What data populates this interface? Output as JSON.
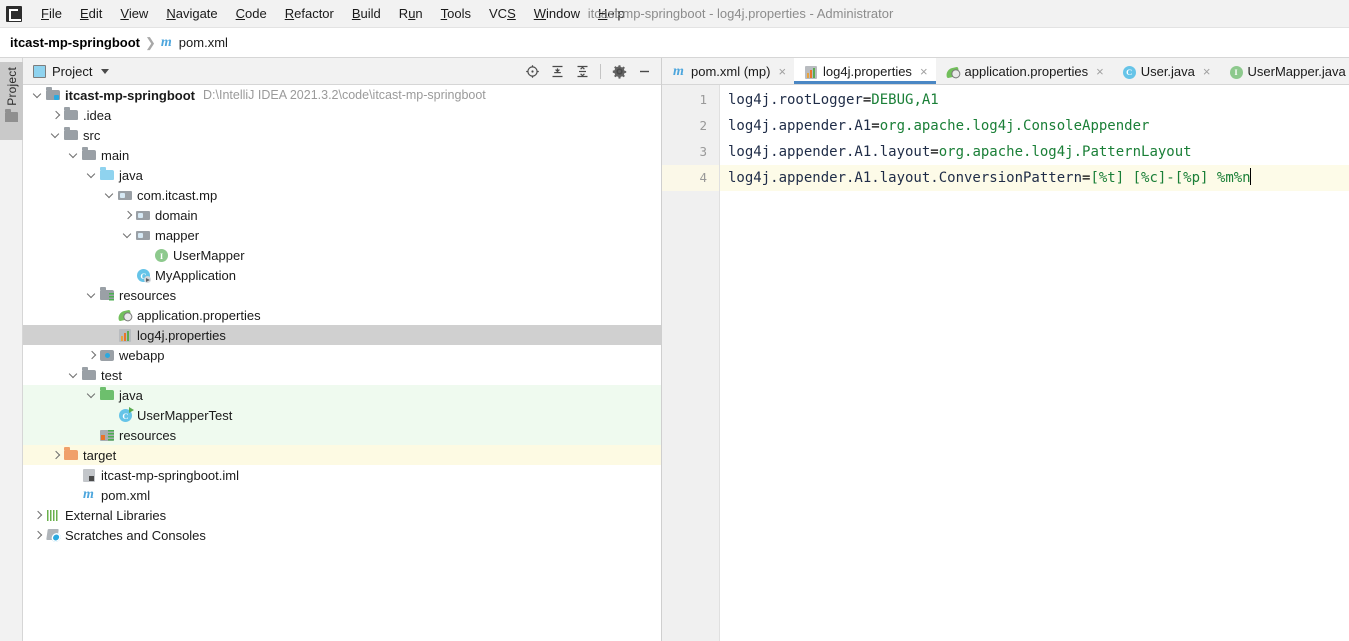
{
  "window": {
    "title": "itcast-mp-springboot - log4j.properties - Administrator"
  },
  "menu": {
    "items": [
      {
        "label": "File",
        "mnemonic": "F"
      },
      {
        "label": "Edit",
        "mnemonic": "E"
      },
      {
        "label": "View",
        "mnemonic": "V"
      },
      {
        "label": "Navigate",
        "mnemonic": "N"
      },
      {
        "label": "Code",
        "mnemonic": "C"
      },
      {
        "label": "Refactor",
        "mnemonic": "R"
      },
      {
        "label": "Build",
        "mnemonic": "B"
      },
      {
        "label": "Run",
        "mnemonic": "u"
      },
      {
        "label": "Tools",
        "mnemonic": "T"
      },
      {
        "label": "VCS",
        "mnemonic": "S"
      },
      {
        "label": "Window",
        "mnemonic": "W"
      },
      {
        "label": "Help",
        "mnemonic": "H"
      }
    ]
  },
  "breadcrumb": {
    "root": "itcast-mp-springboot",
    "separator": "❯",
    "leaf": "pom.xml",
    "leaf_icon": "maven-icon",
    "leaf_icon_glyph": "m"
  },
  "toolstrip": {
    "project_tab_label": "Project",
    "project_tab_icon": "folder-icon"
  },
  "project_panel": {
    "title": "Project",
    "title_icon": "project-view-icon",
    "dropdown_icon": "chevron-down-icon",
    "actions": [
      {
        "name": "select-opened-file-icon",
        "tooltip": "Select Opened File"
      },
      {
        "name": "expand-all-icon",
        "tooltip": "Expand All"
      },
      {
        "name": "collapse-all-icon",
        "tooltip": "Collapse All"
      },
      {
        "name": "gear-icon",
        "tooltip": "Options"
      },
      {
        "name": "hide-icon",
        "tooltip": "Hide"
      }
    ]
  },
  "tree": {
    "rows": [
      {
        "indent": 0,
        "arrow": "down",
        "icon": "module-folder-icon",
        "label": "itcast-mp-springboot",
        "bold": true,
        "hint": "D:\\IntelliJ IDEA 2021.3.2\\code\\itcast-mp-springboot",
        "state": "normal"
      },
      {
        "indent": 1,
        "arrow": "right",
        "icon": "folder-icon",
        "label": ".idea",
        "bold": false,
        "hint": "",
        "state": "normal"
      },
      {
        "indent": 1,
        "arrow": "down",
        "icon": "folder-icon",
        "label": "src",
        "bold": false,
        "hint": "",
        "state": "normal"
      },
      {
        "indent": 2,
        "arrow": "down",
        "icon": "folder-icon",
        "label": "main",
        "bold": false,
        "hint": "",
        "state": "normal"
      },
      {
        "indent": 3,
        "arrow": "down",
        "icon": "source-folder-icon",
        "label": "java",
        "bold": false,
        "hint": "",
        "state": "normal"
      },
      {
        "indent": 4,
        "arrow": "down",
        "icon": "package-icon",
        "label": "com.itcast.mp",
        "bold": false,
        "hint": "",
        "state": "normal"
      },
      {
        "indent": 5,
        "arrow": "right",
        "icon": "package-icon",
        "label": "domain",
        "bold": false,
        "hint": "",
        "state": "normal"
      },
      {
        "indent": 5,
        "arrow": "down",
        "icon": "package-icon",
        "label": "mapper",
        "bold": false,
        "hint": "",
        "state": "normal"
      },
      {
        "indent": 6,
        "arrow": "none",
        "icon": "interface-icon",
        "label": "UserMapper",
        "bold": false,
        "hint": "",
        "state": "normal"
      },
      {
        "indent": 5,
        "arrow": "none",
        "icon": "spring-class-icon",
        "label": "MyApplication",
        "bold": false,
        "hint": "",
        "state": "normal"
      },
      {
        "indent": 3,
        "arrow": "down",
        "icon": "resources-folder-icon",
        "label": "resources",
        "bold": false,
        "hint": "",
        "state": "normal"
      },
      {
        "indent": 4,
        "arrow": "none",
        "icon": "spring-properties-icon",
        "label": "application.properties",
        "bold": false,
        "hint": "",
        "state": "normal"
      },
      {
        "indent": 4,
        "arrow": "none",
        "icon": "properties-file-icon",
        "label": "log4j.properties",
        "bold": false,
        "hint": "",
        "state": "selected"
      },
      {
        "indent": 3,
        "arrow": "right",
        "icon": "webapp-folder-icon",
        "label": "webapp",
        "bold": false,
        "hint": "",
        "state": "normal"
      },
      {
        "indent": 2,
        "arrow": "down",
        "icon": "folder-icon",
        "label": "test",
        "bold": false,
        "hint": "",
        "state": "normal"
      },
      {
        "indent": 3,
        "arrow": "down",
        "icon": "test-source-folder-icon",
        "label": "java",
        "bold": false,
        "hint": "",
        "state": "green"
      },
      {
        "indent": 4,
        "arrow": "none",
        "icon": "test-class-icon",
        "label": "UserMapperTest",
        "bold": false,
        "hint": "",
        "state": "green"
      },
      {
        "indent": 3,
        "arrow": "none",
        "icon": "test-resources-icon",
        "label": "resources",
        "bold": false,
        "hint": "",
        "state": "green"
      },
      {
        "indent": 1,
        "arrow": "right",
        "icon": "target-folder-icon",
        "label": "target",
        "bold": false,
        "hint": "",
        "state": "yellow"
      },
      {
        "indent": 2,
        "arrow": "none",
        "icon": "iml-file-icon",
        "label": "itcast-mp-springboot.iml",
        "bold": false,
        "hint": "",
        "state": "normal"
      },
      {
        "indent": 2,
        "arrow": "none",
        "icon": "maven-icon",
        "label": "pom.xml",
        "bold": false,
        "hint": "",
        "state": "normal"
      },
      {
        "indent": 0,
        "arrow": "right",
        "icon": "external-libraries-icon",
        "label": "External Libraries",
        "bold": false,
        "hint": "",
        "state": "normal"
      },
      {
        "indent": 0,
        "arrow": "right",
        "icon": "scratches-icon",
        "label": "Scratches and Consoles",
        "bold": false,
        "hint": "",
        "state": "normal"
      }
    ]
  },
  "editor": {
    "tabs": [
      {
        "label": "pom.xml (mp)",
        "icon": "maven-icon",
        "active": false,
        "close_glyph": "×"
      },
      {
        "label": "log4j.properties",
        "icon": "properties-file-icon",
        "active": true,
        "close_glyph": "×"
      },
      {
        "label": "application.properties",
        "icon": "spring-properties-icon",
        "active": false,
        "close_glyph": "×"
      },
      {
        "label": "User.java",
        "icon": "class-icon",
        "active": false,
        "close_glyph": "×"
      },
      {
        "label": "UserMapper.java",
        "icon": "interface-icon",
        "active": false,
        "close_glyph": ""
      }
    ],
    "line_numbers": [
      "1",
      "2",
      "3",
      "4"
    ],
    "current_line": 4,
    "lines": [
      {
        "key": "log4j.rootLogger",
        "eq": "=",
        "value": "DEBUG,A1"
      },
      {
        "key": "log4j.appender.A1",
        "eq": "=",
        "value": "org.apache.log4j.ConsoleAppender"
      },
      {
        "key": "log4j.appender.A1.layout",
        "eq": "=",
        "value": "org.apache.log4j.PatternLayout"
      },
      {
        "key": "log4j.appender.A1.layout.ConversionPattern",
        "eq": "=",
        "value": "[%t] [%c]-[%p] %m%n"
      }
    ]
  },
  "colors": {
    "accent": "#4a87c4",
    "selection": "#d0d0d0",
    "test_source": "#effaef",
    "excluded": "#fdfae3",
    "current_line": "#fdfbe8",
    "key_text": "#1f2c47",
    "value_text": "#1a7f37"
  }
}
